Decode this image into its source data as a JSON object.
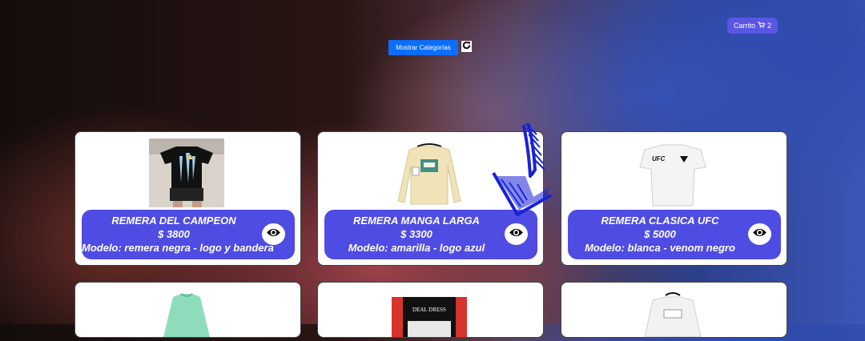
{
  "header": {
    "cart_label": "Carrito",
    "cart_count": "2",
    "categories_button": "Mostrar Categorías"
  },
  "colors": {
    "accent": "#4f4ce3",
    "cart_button": "#5b55e6",
    "primary_button": "#0d6efd",
    "annotation_arrow": "#1a22d6"
  },
  "products": [
    {
      "name": "REMERA DEL CAMPEON",
      "price": "$ 3800",
      "model": "Modelo: remera negra - logo y bandera"
    },
    {
      "name": "REMERA MANGA LARGA",
      "price": "$ 3300",
      "model": "Modelo: amarilla - logo azul"
    },
    {
      "name": "REMERA CLASICA UFC",
      "price": "$ 5000",
      "model": "Modelo: blanca - venom negro"
    }
  ],
  "image_texts": {
    "ufc_logo": "UFC",
    "deal_dress": "DEAL DRESS"
  }
}
